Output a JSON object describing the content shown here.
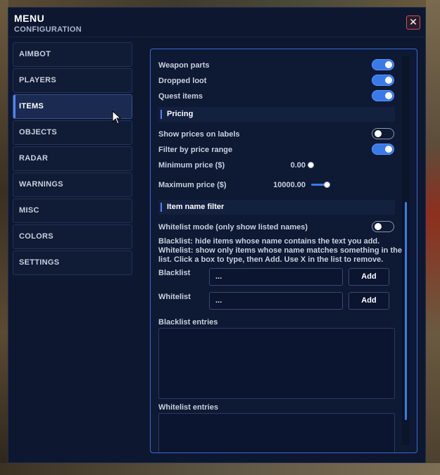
{
  "window": {
    "title": "MENU",
    "subtitle": "CONFIGURATION",
    "close_glyph": "✕"
  },
  "sidebar": {
    "items": [
      {
        "label": "AIMBOT",
        "active": false
      },
      {
        "label": "PLAYERS",
        "active": false
      },
      {
        "label": "ITEMS",
        "active": true
      },
      {
        "label": "OBJECTS",
        "active": false
      },
      {
        "label": "RADAR",
        "active": false
      },
      {
        "label": "WARNINGS",
        "active": false
      },
      {
        "label": "MISC",
        "active": false
      },
      {
        "label": "COLORS",
        "active": false
      },
      {
        "label": "SETTINGS",
        "active": false
      }
    ]
  },
  "items_panel": {
    "toggles_top": [
      {
        "label": "Weapon parts",
        "on": true
      },
      {
        "label": "Dropped loot",
        "on": true
      },
      {
        "label": "Quest items",
        "on": true
      }
    ],
    "pricing": {
      "heading": "Pricing",
      "show_prices": {
        "label": "Show prices on labels",
        "on": false
      },
      "filter_range": {
        "label": "Filter by price range",
        "on": true
      },
      "min_price": {
        "label": "Minimum price ($)",
        "value": "0.00",
        "fraction": 0.0
      },
      "max_price": {
        "label": "Maximum price ($)",
        "value": "10000.00",
        "fraction": 1.0
      }
    },
    "name_filter": {
      "heading": "Item name filter",
      "whitelist_mode": {
        "label": "Whitelist mode (only show listed names)",
        "on": false
      },
      "help_text": "Blacklist: hide items whose name contains the text you add. Whitelist: show only items whose name matches something in the list. Click a box to type, then Add. Use X in the list to remove.",
      "blacklist": {
        "label": "Blacklist",
        "value": "...",
        "add_label": "Add"
      },
      "whitelist": {
        "label": "Whitelist",
        "value": "...",
        "add_label": "Add"
      },
      "blacklist_entries_label": "Blacklist entries",
      "whitelist_entries_label": "Whitelist entries"
    }
  },
  "colors": {
    "accent": "#3a7ae8",
    "panel_bg": "#0d1730",
    "border_accent": "#3a6ad6",
    "close_border": "#c9545c"
  },
  "icons": {
    "close": "close-icon",
    "cursor": "mouse-cursor-icon"
  }
}
